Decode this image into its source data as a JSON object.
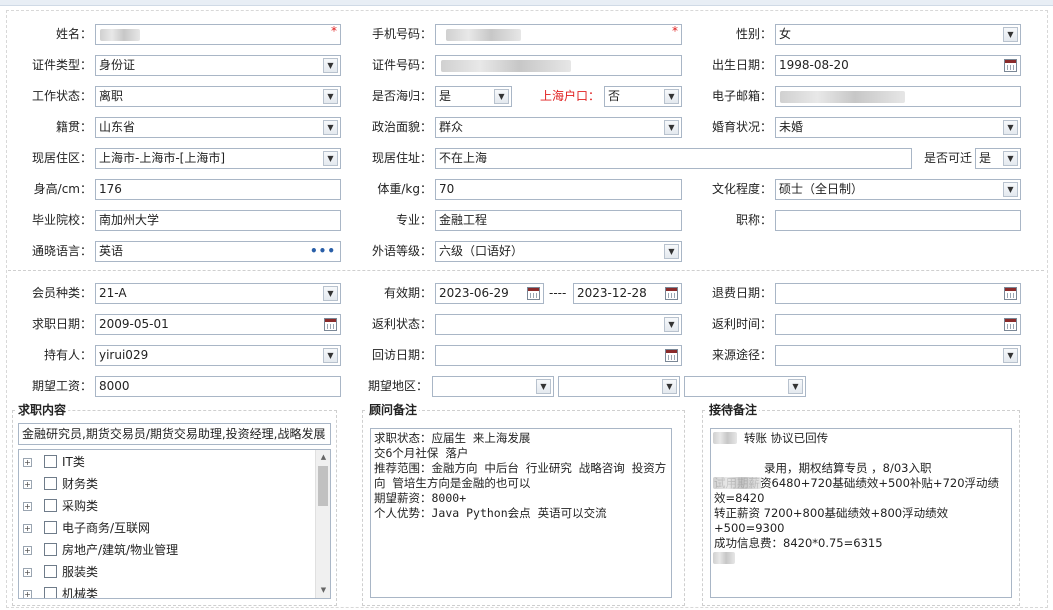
{
  "form": {
    "name": {
      "label": "姓名：",
      "value": "",
      "required": "*"
    },
    "phone": {
      "label": "手机号码：",
      "value": "",
      "required": "*"
    },
    "gender": {
      "label": "性别：",
      "value": "女"
    },
    "id_type": {
      "label": "证件类型：",
      "value": "身份证"
    },
    "id_number": {
      "label": "证件号码：",
      "value": ""
    },
    "birth_date": {
      "label": "出生日期：",
      "value": "1998-08-20"
    },
    "work_status": {
      "label": "工作状态：",
      "value": "离职"
    },
    "returnee": {
      "label": "是否海归：",
      "value": "是"
    },
    "shanghai_hukou": {
      "label": "上海户口：",
      "value": "否"
    },
    "email": {
      "label": "电子邮箱：",
      "value": ""
    },
    "native_place": {
      "label": "籍贯：",
      "value": "山东省"
    },
    "political": {
      "label": "政治面貌：",
      "value": "群众"
    },
    "marital": {
      "label": "婚育状况：",
      "value": "未婚"
    },
    "residence_area": {
      "label": "现居住区：",
      "value": "上海市-上海市-[上海市]"
    },
    "residence_addr": {
      "label": "现居住址：",
      "value": "不在上海"
    },
    "relocatable": {
      "label": "是否可迁",
      "value": "是"
    },
    "height": {
      "label": "身高/cm：",
      "value": "176"
    },
    "weight": {
      "label": "体重/kg：",
      "value": "70"
    },
    "education": {
      "label": "文化程度：",
      "value": "硕士（全日制）"
    },
    "school": {
      "label": "毕业院校：",
      "value": "南加州大学"
    },
    "major": {
      "label": "专业：",
      "value": "金融工程"
    },
    "title": {
      "label": "职称：",
      "value": ""
    },
    "language": {
      "label": "通晓语言：",
      "value": "英语"
    },
    "lang_level": {
      "label": "外语等级：",
      "value": "六级（口语好）"
    },
    "member_type": {
      "label": "会员种类：",
      "value": "21-A"
    },
    "valid_period": {
      "label": "有效期：",
      "start": "2023-06-29",
      "sep": "----",
      "end": "2023-12-28"
    },
    "refund_date": {
      "label": "退费日期：",
      "value": ""
    },
    "apply_date": {
      "label": "求职日期：",
      "value": "2009-05-01"
    },
    "rebate_status": {
      "label": "返利状态：",
      "value": ""
    },
    "rebate_time": {
      "label": "返利时间：",
      "value": ""
    },
    "holder": {
      "label": "持有人：",
      "value": "yirui029"
    },
    "visit_date": {
      "label": "回访日期：",
      "value": ""
    },
    "source": {
      "label": "来源途径：",
      "value": ""
    },
    "expected_salary": {
      "label": "期望工资：",
      "value": "8000"
    },
    "expected_area": {
      "label": "期望地区：",
      "v1": "",
      "v2": "",
      "v3": ""
    }
  },
  "job_content": {
    "title": "求职内容",
    "selected": "金融研究员,期货交易员/期货交易助理,投资经理,战略发展",
    "tree": [
      "IT类",
      "财务类",
      "采购类",
      "电子商务/互联网",
      "房地产/建筑/物业管理",
      "服装类",
      "机械类"
    ]
  },
  "consultant_notes": {
    "title": "顾问备注",
    "lines": [
      "求职状态：应届生 来上海发展",
      "交6个月社保 落户",
      "推荐范围：金融方向 中后台 行业研究 战略咨询 投资方向 管培生方向是金融的也可以",
      "期望薪资：8000+",
      "个人优势：Java Python会点 英语可以交流"
    ]
  },
  "reception_notes": {
    "title": "接待备注",
    "lines": [
      "转账 协议已回传",
      "",
      "录用，期权结算专员 ，8/03入职",
      "试用期薪资6480+720基础绩效+500补贴+720浮动绩效=8420",
      "转正薪资 7200+800基础绩效+800浮动绩效+500=9300",
      "成功信息费：8420*0.75=6315",
      ""
    ]
  }
}
